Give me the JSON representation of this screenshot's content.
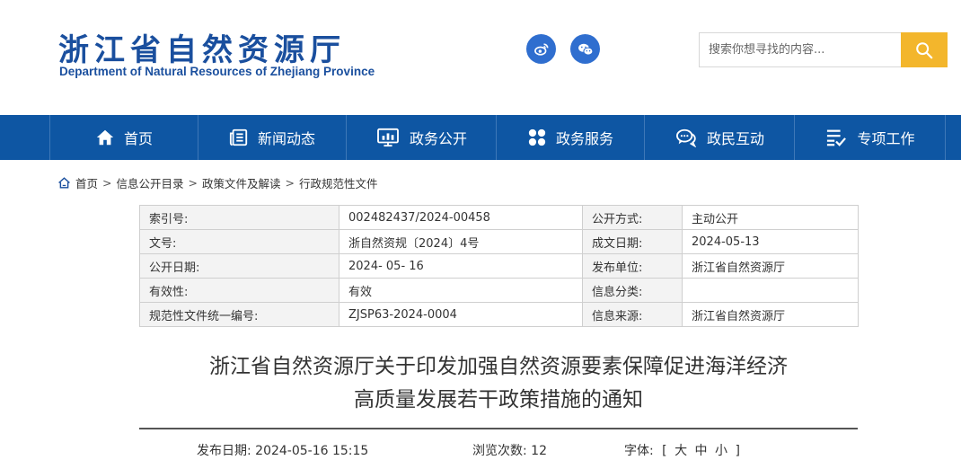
{
  "header": {
    "title_cn": "浙江省自然资源厅",
    "title_en": "Department of Natural Resources of Zhejiang Province",
    "social": [
      "weibo-icon",
      "wechat-icon"
    ],
    "search": {
      "placeholder": "搜索你想寻找的内容..."
    }
  },
  "nav": {
    "items": [
      {
        "label": "首页",
        "icon": "home-icon"
      },
      {
        "label": "新闻动态",
        "icon": "news-icon"
      },
      {
        "label": "政务公开",
        "icon": "monitor-icon"
      },
      {
        "label": "政务服务",
        "icon": "grid-icon"
      },
      {
        "label": "政民互动",
        "icon": "chat-icon"
      },
      {
        "label": "专项工作",
        "icon": "list-check-icon"
      }
    ]
  },
  "breadcrumb": [
    "首页",
    "信息公开目录",
    "政策文件及解读",
    "行政规范性文件"
  ],
  "meta": {
    "rows": [
      {
        "k1": "索引号:",
        "v1": "002482437/2024-00458",
        "k2": "公开方式:",
        "v2": "主动公开"
      },
      {
        "k1": "文号:",
        "v1": "浙自然资规〔2024〕4号",
        "k2": "成文日期:",
        "v2": "2024-05-13"
      },
      {
        "k1": "公开日期:",
        "v1": "2024- 05- 16",
        "k2": "发布单位:",
        "v2": "浙江省自然资源厅"
      },
      {
        "k1": "有效性:",
        "v1": "有效",
        "k2": "信息分类:",
        "v2": ""
      },
      {
        "k1": "规范性文件统一编号:",
        "v1": "ZJSP63-2024-0004",
        "k2": "信息来源:",
        "v2": "浙江省自然资源厅"
      }
    ]
  },
  "document": {
    "title_line1": "浙江省自然资源厅关于印发加强自然资源要素保障促进海洋经济",
    "title_line2": "高质量发展若干政策措施的通知",
    "publish_date": "发布日期: 2024-05-16 15:15",
    "views": "浏览次数: 12",
    "font_label": "字体:",
    "font_open": "[",
    "font_large": "大",
    "font_medium": "中",
    "font_small": "小",
    "font_close": "]"
  },
  "colors": {
    "brand": "#1a4f9e",
    "nav_bg": "#0e56a3",
    "search_btn": "#f3b62c",
    "social": "#2f6ecf"
  }
}
